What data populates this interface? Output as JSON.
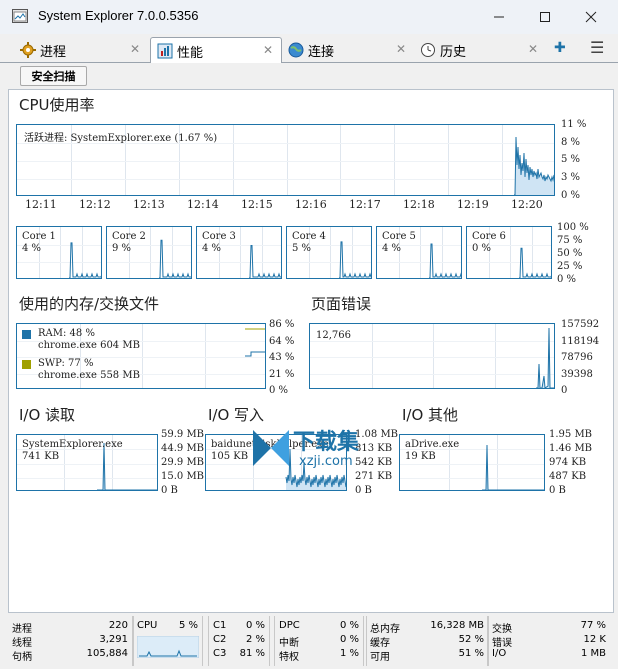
{
  "window": {
    "title": "System Explorer 7.0.0.5356",
    "minimize": "—",
    "maximize": "☐",
    "close": "✕"
  },
  "tabs": [
    {
      "label": "进程",
      "icon": "gear-icon",
      "close": "✕"
    },
    {
      "label": "性能",
      "icon": "performance-icon",
      "close": "✕"
    },
    {
      "label": "连接",
      "icon": "globe-icon",
      "close": "✕"
    },
    {
      "label": "历史",
      "icon": "clock-icon",
      "close": "✕"
    }
  ],
  "tabbar": {
    "add": "✚",
    "menu": "☰"
  },
  "toolbar": {
    "scan_label": "安全扫描"
  },
  "cpu": {
    "title": "CPU使用率",
    "active_process": "活跃进程: SystemExplorer.exe (1.67 %)",
    "yticks": [
      "11 %",
      "8 %",
      "5 %",
      "3 %",
      "0 %"
    ],
    "times": [
      "12:11",
      "12:12",
      "12:13",
      "12:14",
      "12:15",
      "12:16",
      "12:17",
      "12:18",
      "12:19",
      "12:20"
    ],
    "core_yticks": [
      "100 %",
      "75 %",
      "50 %",
      "25 %",
      "0 %"
    ],
    "cores": [
      {
        "name": "Core 1",
        "value": "4 %"
      },
      {
        "name": "Core 2",
        "value": "9 %"
      },
      {
        "name": "Core 3",
        "value": "4 %"
      },
      {
        "name": "Core 4",
        "value": "5 %"
      },
      {
        "name": "Core 5",
        "value": "4 %"
      },
      {
        "name": "Core 6",
        "value": "0 %"
      }
    ]
  },
  "memory": {
    "title": "使用的内存/交换文件",
    "ram_label": "RAM: 48 %",
    "ram_top": "chrome.exe 604 MB",
    "swp_label": "SWP: 77 %",
    "swp_top": "chrome.exe 558 MB",
    "ram_color": "#1e73a8",
    "swp_color": "#a0a000",
    "yticks": [
      "86 %",
      "64 %",
      "43 %",
      "21 %",
      "0 %"
    ]
  },
  "pagefaults": {
    "title": "页面错误",
    "value": "12,766",
    "yticks": [
      "157592",
      "118194",
      "78796",
      "39398",
      "0"
    ]
  },
  "io_read": {
    "title": "I/O 读取",
    "top_process": "SystemExplorer.exe",
    "value": "741 KB",
    "yticks": [
      "59.9 MB",
      "44.9 MB",
      "29.9 MB",
      "15.0 MB",
      "0 B"
    ]
  },
  "io_write": {
    "title": "I/O 写入",
    "top_process": "baidunetdiskhelper.exe",
    "value": "105 KB",
    "yticks": [
      "1.08 MB",
      "813 KB",
      "542 KB",
      "271 KB",
      "0 B"
    ]
  },
  "io_other": {
    "title": "I/O 其他",
    "top_process": "aDrive.exe",
    "value": "19 KB",
    "yticks": [
      "1.95 MB",
      "1.46 MB",
      "974 KB",
      "487 KB",
      "0 B"
    ]
  },
  "status": {
    "processes_label": "进程",
    "processes_value": "220",
    "threads_label": "线程",
    "threads_value": "3,291",
    "handles_label": "句柄",
    "handles_value": "105,884",
    "cpu_label": "CPU",
    "cpu_value": "5 %",
    "c1_label": "C1",
    "c1_value": "0 %",
    "c2_label": "C2",
    "c2_value": "2 %",
    "c3_label": "C3",
    "c3_value": "81 %",
    "dpc_label": "DPC",
    "dpc_value": "0 %",
    "interrupt_label": "中断",
    "interrupt_value": "0 %",
    "privileged_label": "特权",
    "privileged_value": "1 %",
    "total_mem_label": "总内存",
    "total_mem_value": "16,328 MB",
    "cache_label": "缓存",
    "cache_value": "52 %",
    "available_label": "可用",
    "available_value": "51 %",
    "swap_label": "交换",
    "swap_value": "77 %",
    "errors_label": "错误",
    "errors_value": "12 K",
    "io_label": "I/O",
    "io_value": "1 MB"
  },
  "watermark": {
    "text": "下载集",
    "sub": "xzji.com"
  }
}
